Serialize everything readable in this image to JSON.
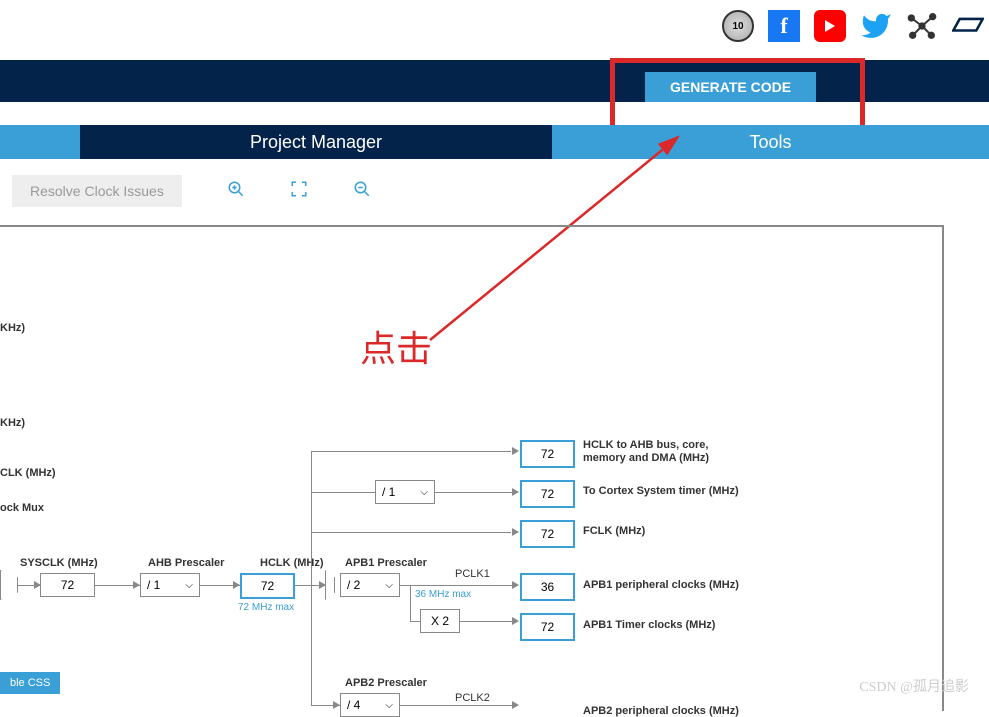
{
  "header": {
    "generate_code": "GENERATE CODE"
  },
  "tabs": {
    "pm": "Project Manager",
    "tools": "Tools"
  },
  "toolbar": {
    "resolve": "Resolve Clock Issues"
  },
  "annotation": {
    "label": "点击"
  },
  "labels": {
    "khz1": "KHz)",
    "khz2": "KHz)",
    "clk": "CLK (MHz)",
    "mux": "ock Mux",
    "sysclk": "SYSCLK (MHz)",
    "ahb_prescaler": "AHB Prescaler",
    "hclk": "HCLK (MHz)",
    "hclk_max": "72 MHz max",
    "apb1_prescaler": "APB1 Prescaler",
    "pclk1": "PCLK1",
    "p36max": "36 MHz max",
    "apb2_prescaler": "APB2 Prescaler",
    "pclk2": "PCLK2",
    "css": "ble CSS"
  },
  "values": {
    "sysclk": "72",
    "ahb": "/ 1",
    "hclk": "72",
    "div1": "/ 1",
    "apb1": "/ 2",
    "x2": "X 2",
    "apb2": "/ 4",
    "out1": "72",
    "out2": "72",
    "out3": "72",
    "out4": "36",
    "out5": "72"
  },
  "outputs": {
    "o1a": "HCLK to AHB bus, core,",
    "o1b": "memory and DMA (MHz)",
    "o2": "To Cortex System timer (MHz)",
    "o3": "FCLK (MHz)",
    "o4": "APB1 peripheral clocks (MHz)",
    "o5": "APB1 Timer clocks (MHz)",
    "o6": "APB2 peripheral clocks (MHz)"
  },
  "watermark": "CSDN @孤月追影"
}
